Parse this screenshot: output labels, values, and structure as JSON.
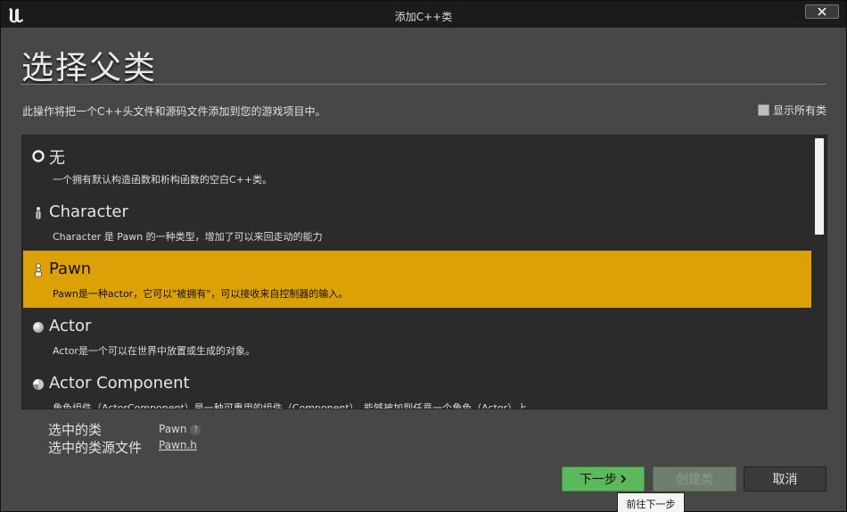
{
  "window": {
    "title": "添加C++类",
    "close_label": "✕"
  },
  "dialog": {
    "heading": "选择父类",
    "description": "此操作将把一个C++头文件和源码文件添加到您的游戏项目中。",
    "show_all_label": "显示所有类",
    "show_all_checked": false
  },
  "classes": [
    {
      "title": "无",
      "description": "一个拥有默认构造函数和析构函数的空白C++类。",
      "icon": "empty-circle-icon",
      "selected": false
    },
    {
      "title": "Character",
      "description": "Character 是 Pawn 的一种类型，增加了可以来回走动的能力",
      "icon": "character-icon",
      "selected": false
    },
    {
      "title": "Pawn",
      "description": "Pawn是一种actor，它可以\"被拥有\"，可以接收来自控制器的输入。",
      "icon": "pawn-icon",
      "selected": true
    },
    {
      "title": "Actor",
      "description": "Actor是一个可以在世界中放置或生成的对象。",
      "icon": "actor-sphere-icon",
      "selected": false
    },
    {
      "title": "Actor Component",
      "description": "角色组件（ActorComponent）是一种可重用的组件（Component），能够被加到任意一个角色（Actor）上",
      "icon": "actor-component-icon",
      "selected": false
    }
  ],
  "selection": {
    "class_label": "选中的类",
    "class_value": "Pawn",
    "source_label": "选中的类源文件",
    "source_value": "Pawn.h"
  },
  "buttons": {
    "next": "下一步",
    "create": "创建类",
    "cancel": "取消"
  },
  "tooltip": "前往下一步",
  "colors": {
    "selected_row": "#dba107",
    "next_button": "#5cb85c",
    "background": "#474747"
  }
}
